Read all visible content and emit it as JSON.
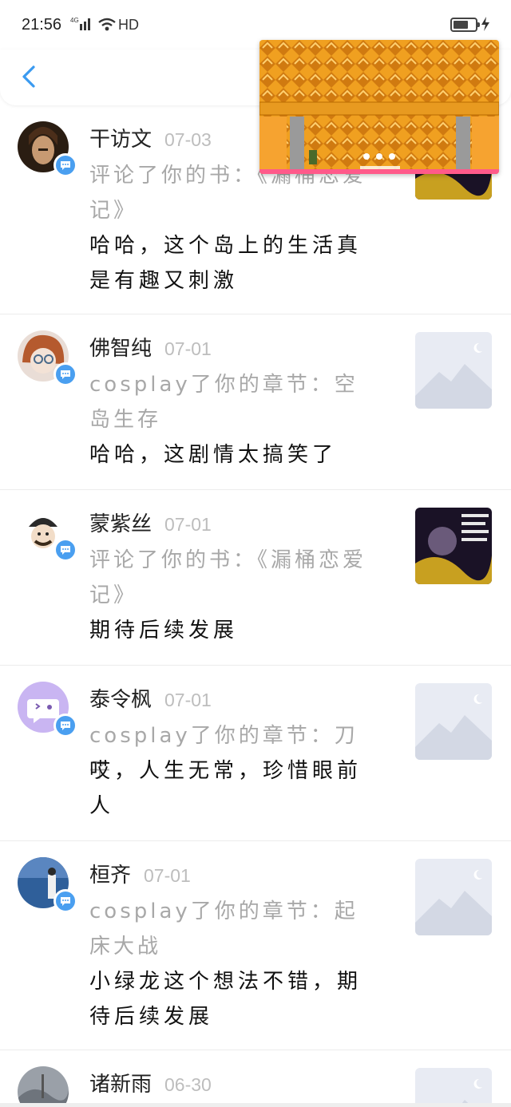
{
  "status_bar": {
    "time": "21:56",
    "signal": "4G",
    "network": "HD"
  },
  "nav": {
    "back_icon": "chevron-left-icon",
    "accent": "#3a9af0"
  },
  "overlay": {
    "game_name": "game-preview"
  },
  "notifications": [
    {
      "name": "干访文",
      "date": "07-03",
      "action": "评论了你的书：《漏桶恋爱记》",
      "comment": "哈哈，这个岛上的生活真是有趣又刺激",
      "thumb": "book-cover"
    },
    {
      "name": "佛智纯",
      "date": "07-01",
      "action": "cosplay了你的章节：空岛生存",
      "comment": "哈哈，这剧情太搞笑了",
      "thumb": "placeholder-image"
    },
    {
      "name": "蒙紫丝",
      "date": "07-01",
      "action": "评论了你的书：《漏桶恋爱记》",
      "comment": "期待后续发展",
      "thumb": "book-cover"
    },
    {
      "name": "泰令枫",
      "date": "07-01",
      "action": "cosplay了你的章节：刀子",
      "comment": "哎，人生无常，珍惜眼前人",
      "thumb": "placeholder-image"
    },
    {
      "name": "桓齐",
      "date": "07-01",
      "action": "cosplay了你的章节：起床大战",
      "comment": "小绿龙这个想法不错，期待后续发展",
      "thumb": "placeholder-image"
    },
    {
      "name": "诸新雨",
      "date": "06-30",
      "action": "",
      "comment": "",
      "thumb": "placeholder-image"
    }
  ],
  "colors": {
    "badge": "#4a9ff0",
    "date": "#bdbdbd",
    "action": "#a8a8a8"
  }
}
